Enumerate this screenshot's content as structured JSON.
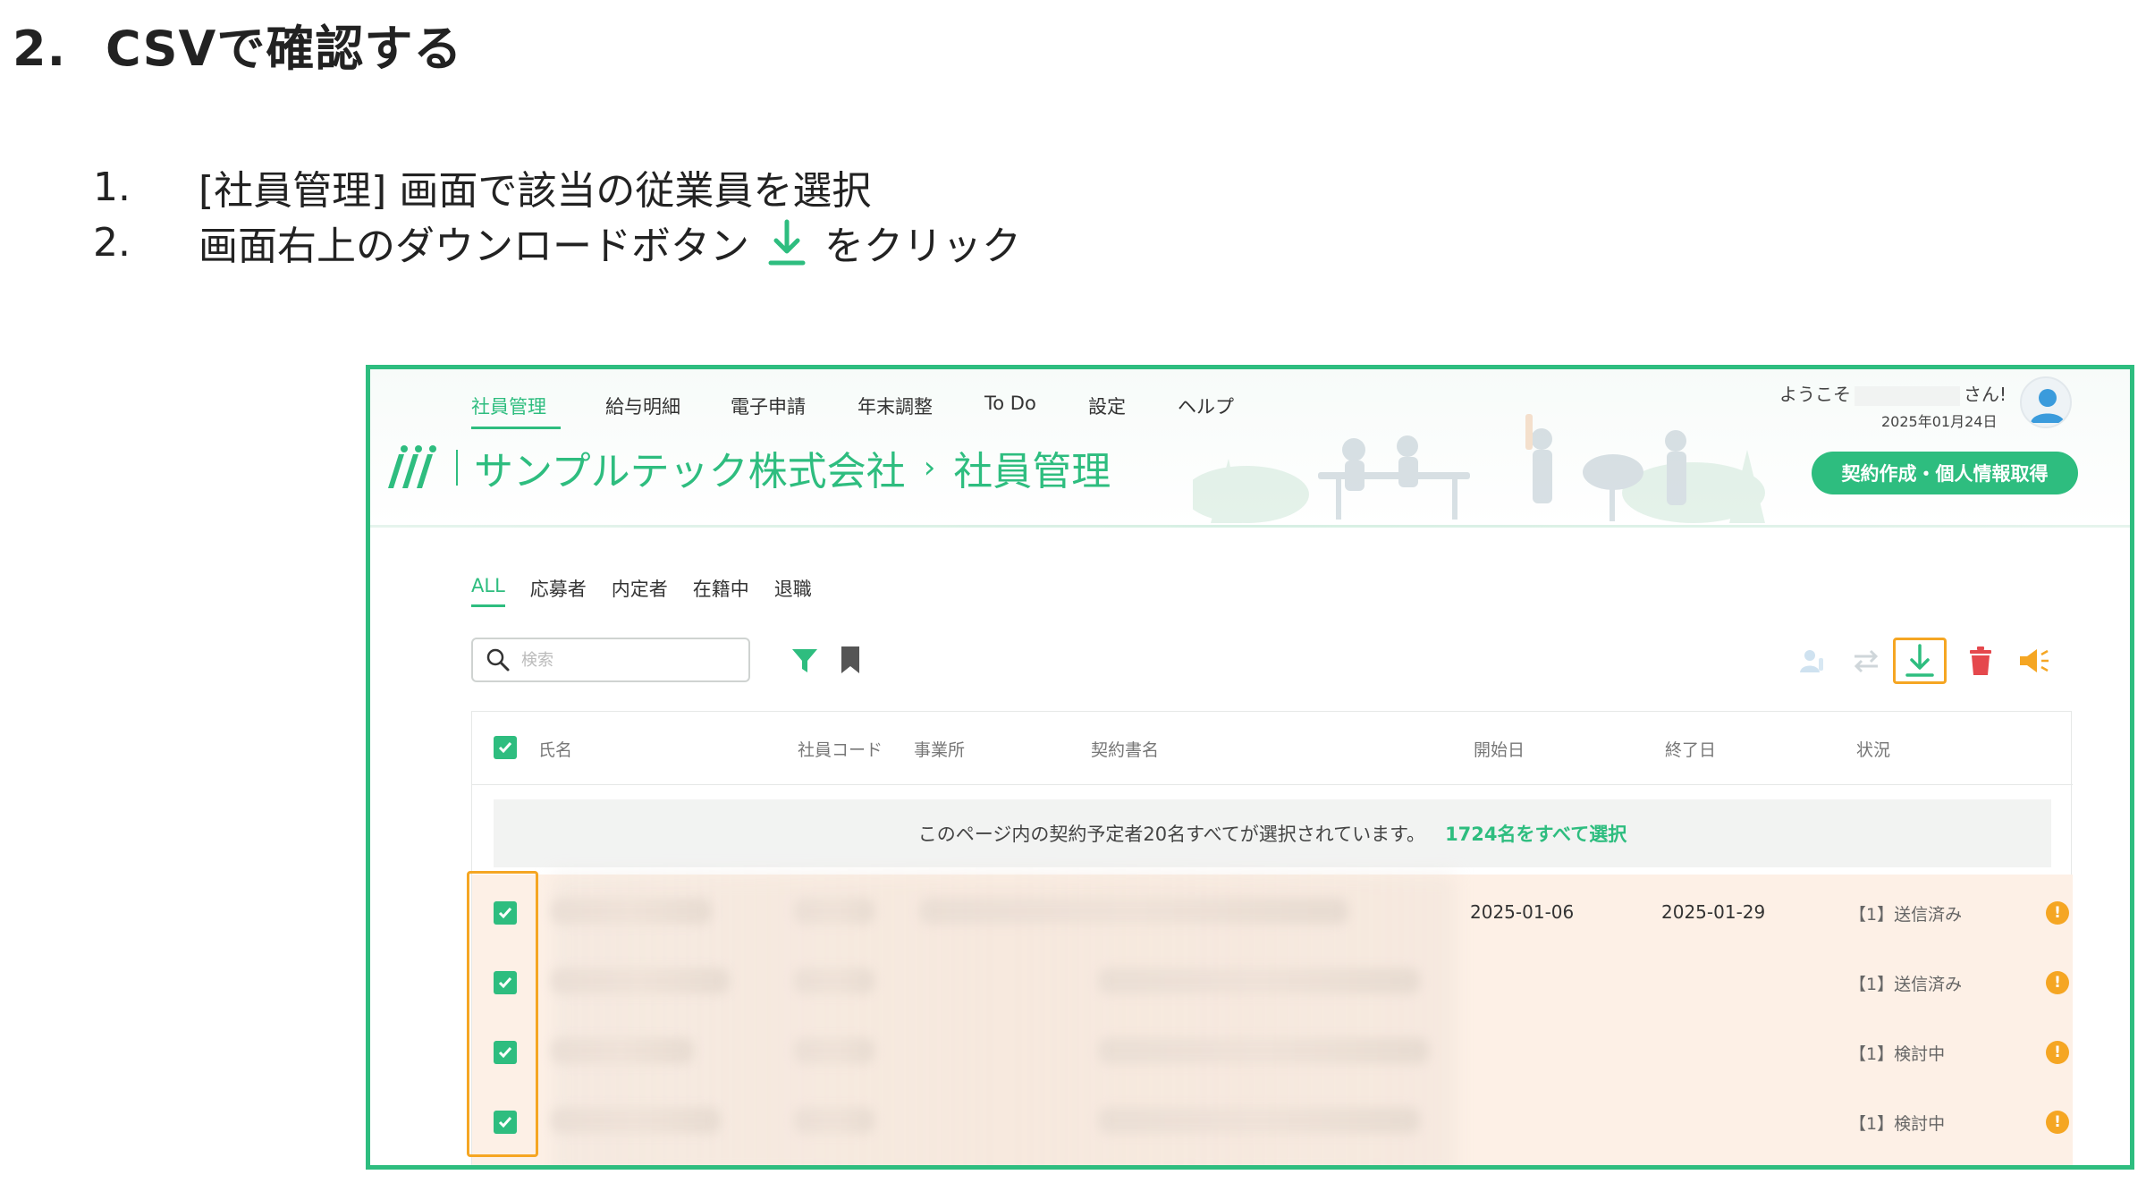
{
  "doc": {
    "section_number": "2.",
    "section_title": "CSVで確認する",
    "steps": [
      {
        "num": "1.",
        "text": "[社員管理] 画面で該当の従業員を選択"
      },
      {
        "num": "2.",
        "text_before": "画面右上のダウンロードボタン",
        "text_after": "をクリック"
      }
    ]
  },
  "app": {
    "nav": [
      "社員管理",
      "給与明細",
      "電子申請",
      "年末調整",
      "To Do",
      "設定",
      "ヘルプ"
    ],
    "welcome_prefix": "ようこそ",
    "welcome_suffix": "さん!",
    "date": "2025年01月24日",
    "company": "サンプルテック株式会社",
    "breadcrumb_sep": "›",
    "page": "社員管理",
    "contract_button": "契約作成・個人情報取得",
    "tabs": [
      "ALL",
      "応募者",
      "内定者",
      "在籍中",
      "退職"
    ],
    "search_placeholder": "検索",
    "columns": [
      "氏名",
      "社員コード",
      "事業所",
      "契約書名",
      "開始日",
      "終了日",
      "状況"
    ],
    "selection_banner": "このページ内の契約予定者20名すべてが選択されています。",
    "select_all_link": "1724名をすべて選択",
    "rows": [
      {
        "start": "2025-01-06",
        "end": "2025-01-29",
        "status": "【1】送信済み"
      },
      {
        "start": "",
        "end": "",
        "status": "【1】送信済み"
      },
      {
        "start": "",
        "end": "",
        "status": "【1】検討中"
      },
      {
        "start": "",
        "end": "",
        "status": "【1】検討中"
      }
    ],
    "colors": {
      "brand": "#2ebd7f",
      "highlight": "#f5a623",
      "danger": "#e5484d"
    }
  }
}
